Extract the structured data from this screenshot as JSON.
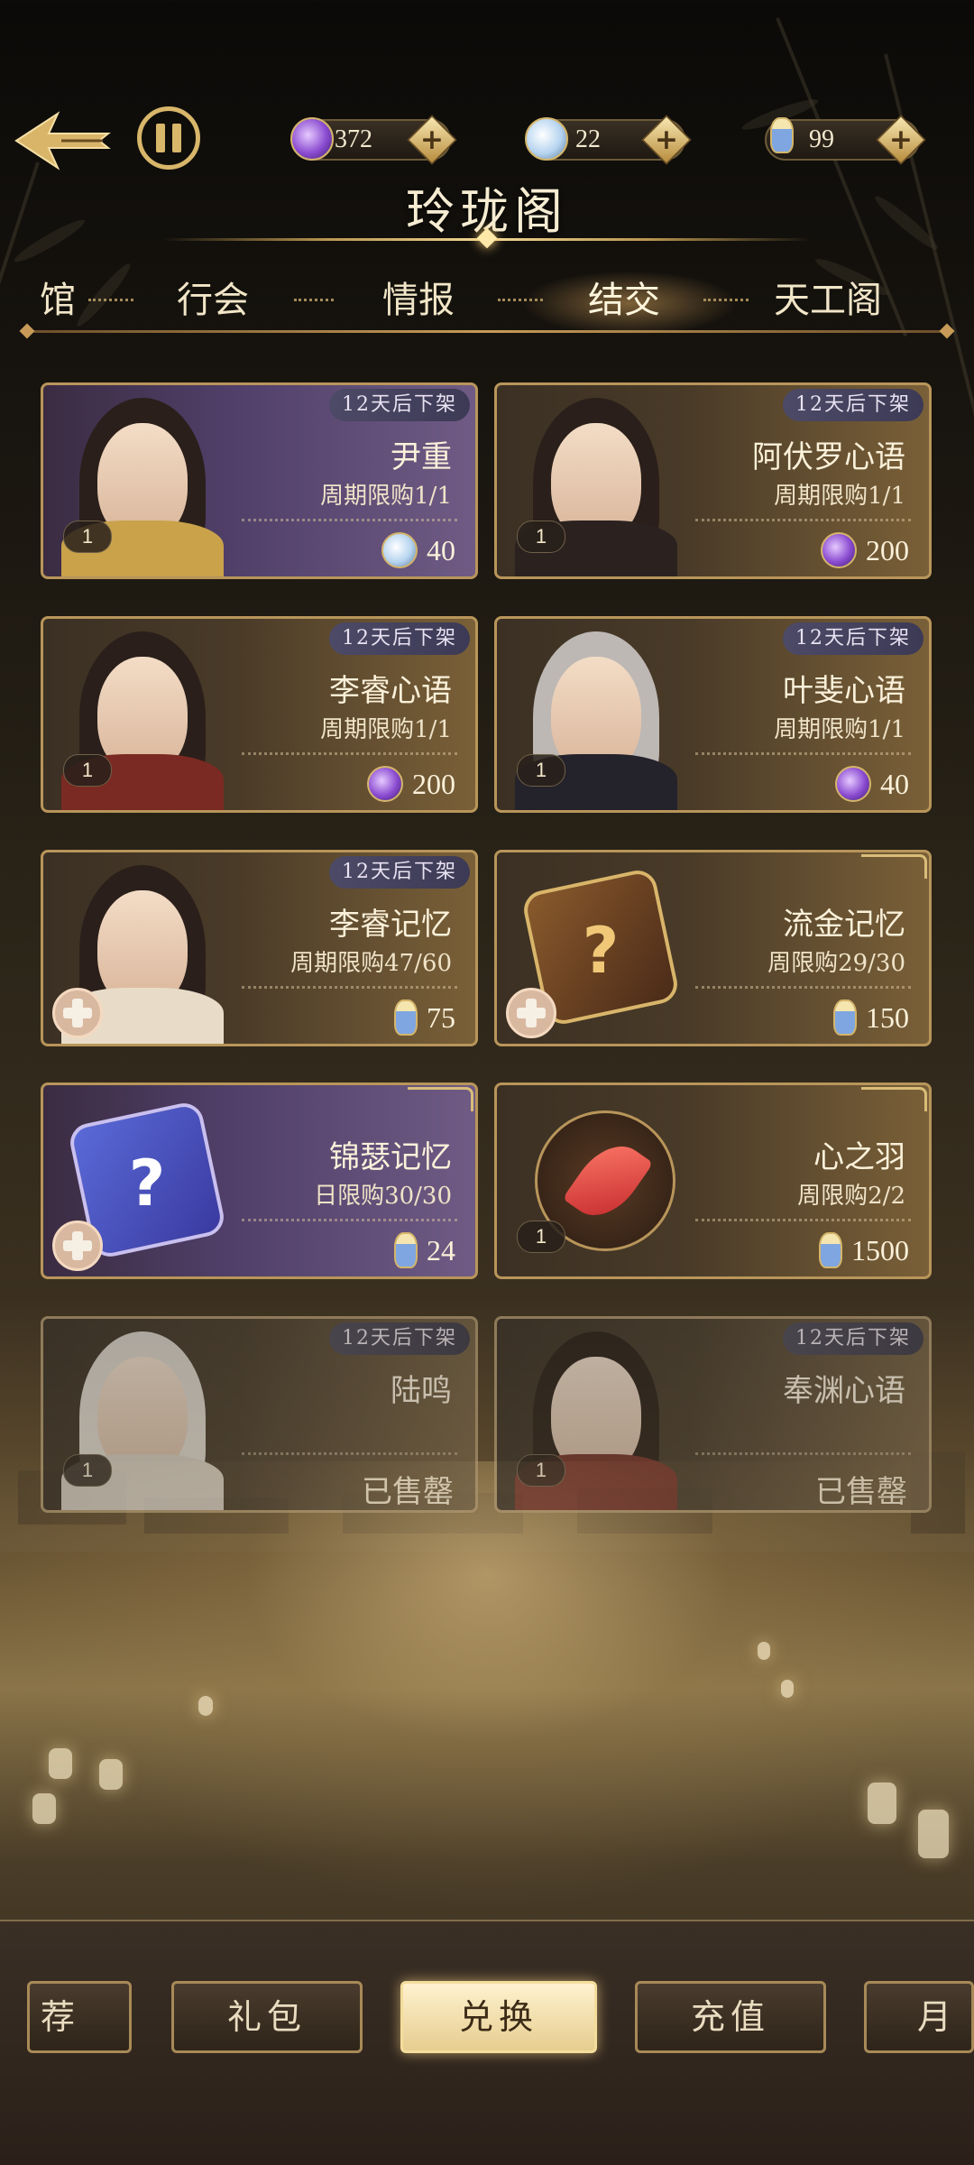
{
  "app": {
    "title": "玲珑阁"
  },
  "currencies": [
    {
      "icon": "purple-jade-icon",
      "value": "372"
    },
    {
      "icon": "silver-orb-icon",
      "value": "22"
    },
    {
      "icon": "bottle-icon",
      "value": "99"
    }
  ],
  "tabs": [
    {
      "label": "馆",
      "active": false
    },
    {
      "label": "行会",
      "active": false
    },
    {
      "label": "情报",
      "active": false
    },
    {
      "label": "结交",
      "active": true
    },
    {
      "label": "天工阁",
      "active": false
    }
  ],
  "items": [
    {
      "name": "尹重",
      "limit": "周期限购1/1",
      "tag": "12天后下架",
      "count": "1",
      "price": "40",
      "currency": "silver-orb-icon",
      "status": "available"
    },
    {
      "name": "阿伏罗心语",
      "limit": "周期限购1/1",
      "tag": "12天后下架",
      "count": "1",
      "price": "200",
      "currency": "purple-jade-icon",
      "status": "available"
    },
    {
      "name": "李睿心语",
      "limit": "周期限购1/1",
      "tag": "12天后下架",
      "count": "1",
      "price": "200",
      "currency": "purple-jade-icon",
      "status": "available"
    },
    {
      "name": "叶斐心语",
      "limit": "周期限购1/1",
      "tag": "12天后下架",
      "count": "1",
      "price": "40",
      "currency": "purple-jade-icon",
      "status": "available"
    },
    {
      "name": "李睿记忆",
      "limit": "周期限购47/60",
      "tag": "12天后下架",
      "price": "75",
      "currency": "bottle-icon",
      "status": "available"
    },
    {
      "name": "流金记忆",
      "limit": "周限购29/30",
      "price": "150",
      "currency": "bottle-icon",
      "status": "available"
    },
    {
      "name": "锦瑟记忆",
      "limit": "日限购30/30",
      "price": "24",
      "currency": "bottle-icon",
      "status": "available"
    },
    {
      "name": "心之羽",
      "limit": "周限购2/2",
      "count": "1",
      "price": "1500",
      "currency": "bottle-icon",
      "status": "available"
    },
    {
      "name": "陆鸣",
      "tag": "12天后下架",
      "count": "1",
      "sold": "已售罄",
      "status": "soldout"
    },
    {
      "name": "奉渊心语",
      "tag": "12天后下架",
      "count": "1",
      "sold": "已售罄",
      "status": "soldout"
    }
  ],
  "bottom_nav": [
    {
      "label": "荐",
      "active": false
    },
    {
      "label": "礼包",
      "active": false
    },
    {
      "label": "兑换",
      "active": true
    },
    {
      "label": "充值",
      "active": false
    },
    {
      "label": "月",
      "active": false
    }
  ],
  "colors": {
    "gold": "#b8955a",
    "accent": "#f3d895",
    "background": "#1a1610"
  }
}
